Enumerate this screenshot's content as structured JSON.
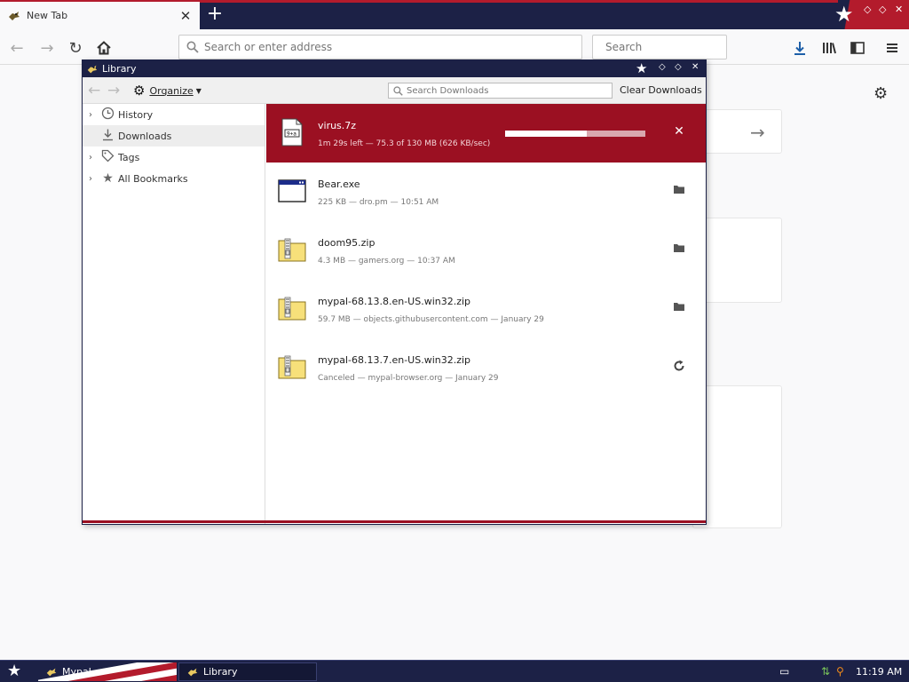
{
  "browser": {
    "tab": {
      "title": "New Tab",
      "close_glyph": "✕",
      "icon": "mypal-bird-icon"
    },
    "new_tab_glyph": "+",
    "nav": {
      "back_glyph": "←",
      "forward_glyph": "→",
      "reload_glyph": "↻",
      "home_glyph": "⌂"
    },
    "url_placeholder": "Search or enter address",
    "search_placeholder": "Search",
    "toolbar_icons": [
      "download-icon",
      "library-icon",
      "sidebar-icon",
      "menu-icon"
    ]
  },
  "library": {
    "title": "Library",
    "toolbar": {
      "organize_label": "Organize",
      "search_placeholder": "Search Downloads",
      "clear_label": "Clear Downloads"
    },
    "sidebar": [
      {
        "label": "History",
        "icon": "clock-icon",
        "expandable": true
      },
      {
        "label": "Downloads",
        "icon": "download-icon",
        "expandable": false,
        "selected": true
      },
      {
        "label": "Tags",
        "icon": "tag-icon",
        "expandable": true
      },
      {
        "label": "All Bookmarks",
        "icon": "star-icon",
        "expandable": true
      }
    ],
    "downloads": [
      {
        "name": "virus.7z",
        "status": "1m 29s left — 75.3 of 130 MB (626 KB/sec)",
        "active": true,
        "progress": 0.58,
        "action": "cancel-icon",
        "file_icon": "7z-file-icon"
      },
      {
        "name": "Bear.exe",
        "status": "225 KB — dro.pm — 10:51 AM",
        "action": "folder-icon",
        "file_icon": "exe-window-icon"
      },
      {
        "name": "doom95.zip",
        "status": "4.3 MB — gamers.org — 10:37 AM",
        "action": "folder-icon",
        "file_icon": "zip-folder-icon"
      },
      {
        "name": "mypal-68.13.8.en-US.win32.zip",
        "status": "59.7 MB — objects.githubusercontent.com — January 29",
        "action": "folder-icon",
        "file_icon": "zip-folder-icon"
      },
      {
        "name": "mypal-68.13.7.en-US.win32.zip",
        "status": "Canceled — mypal-browser.org — January 29",
        "action": "retry-icon",
        "file_icon": "zip-folder-icon"
      }
    ]
  },
  "taskbar": {
    "items": [
      {
        "label": "Mypal"
      },
      {
        "label": "Library"
      }
    ],
    "clock": "11:19 AM"
  },
  "colors": {
    "navy": "#1c2146",
    "red": "#9b1022",
    "flag_red": "#b31b2c"
  }
}
